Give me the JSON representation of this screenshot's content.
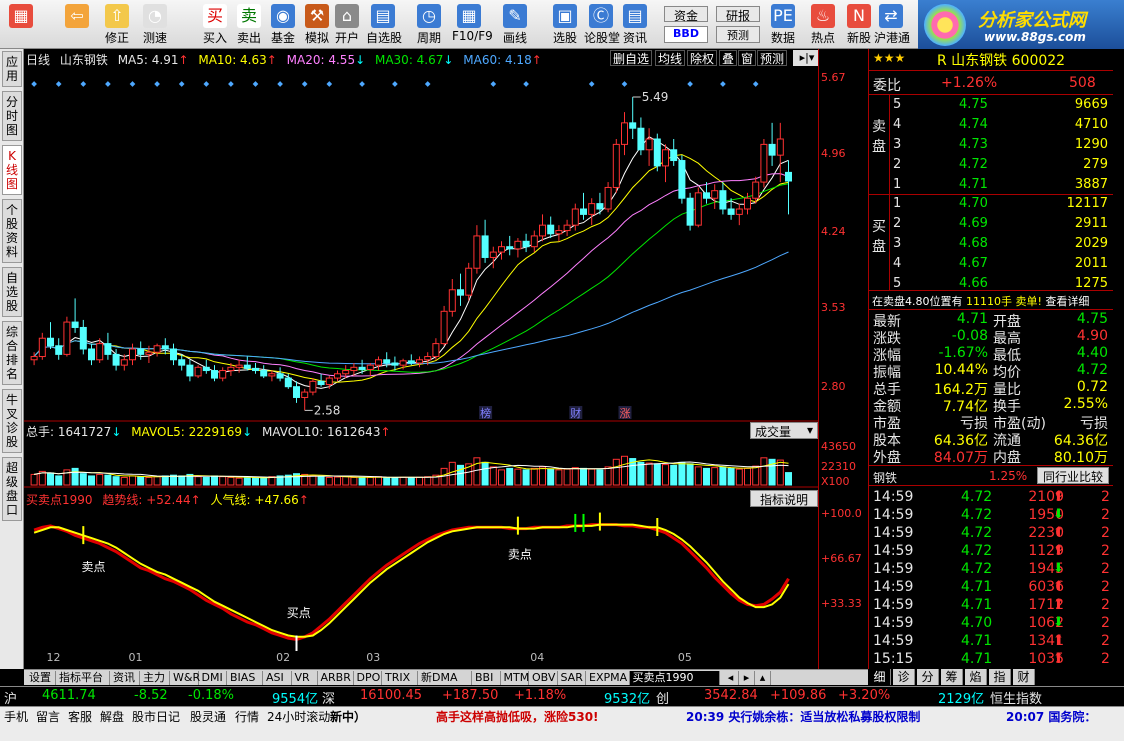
{
  "toolbar": {
    "buttons": [
      {
        "label": "",
        "icon": "home-grid-icon"
      },
      {
        "label": "",
        "icon": "back-icon"
      },
      {
        "label": "修正",
        "icon": "refresh-icon"
      },
      {
        "label": "测速",
        "icon": "clock-icon"
      },
      {
        "label": "买入",
        "icon": "buy-icon"
      },
      {
        "label": "卖出",
        "icon": "sell-icon"
      },
      {
        "label": "基金",
        "icon": "fund-icon"
      },
      {
        "label": "模拟",
        "icon": "hammer-icon"
      },
      {
        "label": "开户",
        "icon": "lock-icon"
      },
      {
        "label": "自选股",
        "icon": "watchlist-icon"
      },
      {
        "label": "周期",
        "icon": "period-icon"
      },
      {
        "label": "F10/F9",
        "icon": "f10-icon"
      },
      {
        "label": "画线",
        "icon": "pen-icon"
      },
      {
        "label": "选股",
        "icon": "screen-icon"
      },
      {
        "label": "论股堂",
        "icon": "forum-icon"
      },
      {
        "label": "资讯",
        "icon": "news-icon"
      },
      {
        "label": "资金",
        "icon": "capital-icon"
      },
      {
        "label": "研报",
        "icon": "report-icon"
      },
      {
        "label": "数据",
        "icon": "pe-icon"
      },
      {
        "label": "热点",
        "icon": "hot-icon"
      },
      {
        "label": "新股",
        "icon": "newstock-icon"
      },
      {
        "label": "沪港通",
        "icon": "hk-icon"
      }
    ],
    "bbd": "BBD",
    "forecast": "预测"
  },
  "logo": {
    "text": "分析家公式网",
    "url": "www.88gs.com"
  },
  "left_tabs": [
    "应用",
    "分时图",
    "K线图",
    "个股资料",
    "自选股",
    "综合排名",
    "牛叉诊股",
    "超级盘口"
  ],
  "chart_header": {
    "period": "日线",
    "name": "山东钢铁",
    "ma5": "MA5: 4.91",
    "ma10": "MA10: 4.63",
    "ma20": "MA20: 4.55",
    "ma30": "MA30: 4.67",
    "ma60": "MA60: 4.18",
    "btns": [
      "删自选",
      "均线",
      "除权",
      "叠",
      "窗",
      "预测"
    ]
  },
  "price_axis": [
    "5.67",
    "4.96",
    "4.24",
    "3.53",
    "2.80"
  ],
  "annot": {
    "high": "5.49",
    "low": "2.58",
    "bang": "榜",
    "cai": "财",
    "zhang": "涨"
  },
  "vol_header": {
    "total": "总手: 1641727",
    "mavol5": "MAVOL5: 2229169",
    "mavol10": "MAVOL10: 1612643",
    "select": "成交量"
  },
  "vol_axis": [
    "43650",
    "22310",
    "X100"
  ],
  "ind_header": {
    "name": "买卖点1990",
    "trend": "趋势线: +52.44",
    "pop": "人气线: +47.66",
    "btn": "指标说明"
  },
  "ind_axis": [
    "+100.0",
    "+66.67",
    "+33.33"
  ],
  "ind_labels": {
    "sell1": "卖点",
    "sell2": "卖点",
    "buy": "买点"
  },
  "date_axis": [
    "12",
    "01",
    "02",
    "03",
    "04",
    "05"
  ],
  "bottom_tabs": [
    "设置",
    "指标平台",
    "资讯",
    "主力",
    "W&R",
    "DMI",
    "BIAS",
    "ASI",
    "VR",
    "ARBR",
    "DPO",
    "TRIX",
    "新DMA",
    "BBI",
    "MTM",
    "OBV",
    "SAR",
    "EXPMA",
    "买卖点1990"
  ],
  "panel": {
    "stars": "★★★",
    "code_title": "R 山东钢铁 600022",
    "webi": "委比",
    "webi_pct": "+1.26%",
    "webi_val": "508",
    "sell_label": "卖盘",
    "buy_label": "买盘",
    "asks": [
      {
        "n": "5",
        "p": "4.75",
        "v": "9669"
      },
      {
        "n": "4",
        "p": "4.74",
        "v": "4710"
      },
      {
        "n": "3",
        "p": "4.73",
        "v": "1290"
      },
      {
        "n": "2",
        "p": "4.72",
        "v": "279"
      },
      {
        "n": "1",
        "p": "4.71",
        "v": "3887"
      }
    ],
    "bids": [
      {
        "n": "1",
        "p": "4.70",
        "v": "12117"
      },
      {
        "n": "2",
        "p": "4.69",
        "v": "2911"
      },
      {
        "n": "3",
        "p": "4.68",
        "v": "2029"
      },
      {
        "n": "4",
        "p": "4.67",
        "v": "2011"
      },
      {
        "n": "5",
        "p": "4.66",
        "v": "1275"
      }
    ],
    "notice": "在卖盘4.80位置有",
    "notice2": "11110手 卖单!",
    "detail": "查看详细",
    "quote": [
      [
        "最新",
        "4.71",
        "开盘",
        "4.75"
      ],
      [
        "涨跌",
        "-0.08",
        "最高",
        "4.90"
      ],
      [
        "涨幅",
        "-1.67%",
        "最低",
        "4.40"
      ],
      [
        "振幅",
        "10.44%",
        "均价",
        "4.72"
      ],
      [
        "总手",
        "164.2万",
        "量比",
        "0.72"
      ],
      [
        "金额",
        "7.74亿",
        "换手",
        "2.55%"
      ],
      [
        "市盈",
        "亏损",
        "市盈(动)",
        "亏损"
      ],
      [
        "股本",
        "64.36亿",
        "流通",
        "64.36亿"
      ],
      [
        "外盘",
        "84.07万",
        "内盘",
        "80.10万"
      ]
    ],
    "industry": "钢铁",
    "industry_pct": "1.25%",
    "industry_btn": "同行业比较",
    "ticks": [
      [
        "14:59",
        "4.72",
        "2109",
        "2"
      ],
      [
        "14:59",
        "4.72",
        "1950",
        "2"
      ],
      [
        "14:59",
        "4.72",
        "2230",
        "2"
      ],
      [
        "14:59",
        "4.72",
        "1129",
        "2"
      ],
      [
        "14:59",
        "4.72",
        "1945",
        "2"
      ],
      [
        "14:59",
        "4.71",
        "6036",
        "2"
      ],
      [
        "14:59",
        "4.71",
        "1712",
        "2"
      ],
      [
        "14:59",
        "4.70",
        "1062",
        "2"
      ],
      [
        "14:59",
        "4.71",
        "1341",
        "2"
      ],
      [
        "15:15",
        "4.71",
        "1035",
        "2"
      ]
    ],
    "tabs": [
      "细",
      "诊",
      "分",
      "筹",
      "焰",
      "指",
      "财"
    ]
  },
  "index_bar": {
    "sh": "沪",
    "sh_val": "4611.74",
    "sh_chg": "-8.52",
    "sh_pct": "-0.18%",
    "sh_amt": "9554亿",
    "sz": "深",
    "sz_val": "16100.45",
    "sz_chg": "+187.50",
    "sz_pct": "+1.18%",
    "sz_amt": "9532亿",
    "cy": "创",
    "cy_val": "3542.84",
    "cy_chg": "+109.86",
    "cy_pct": "+3.20%",
    "cy_amt": "2129亿",
    "hs": "恒生指数"
  },
  "status": {
    "items": [
      "手机",
      "留言",
      "客服",
      "解盘",
      "股市日记",
      "股灵通",
      "行情",
      "24小时滚动"
    ],
    "news1": "新中）",
    "news2": "高手这样高抛低吸，涨险530!",
    "news3": "20:39 央行姚余栋：适当放松私募股权限制",
    "news4": "20:07 国务院："
  },
  "colors": {
    "up": "#ff3232",
    "down": "#54ffff",
    "ma5": "#ffffff",
    "ma10": "#ffff00",
    "ma20": "#ff80ff",
    "ma30": "#00e600",
    "ma60": "#4ea8ff"
  },
  "chart_data": {
    "type": "candlestick",
    "series": [
      {
        "name": "日线",
        "x": "trading day index",
        "values": [
          [
            3.05,
            3.12,
            3.0,
            3.08
          ],
          [
            3.08,
            3.3,
            3.05,
            3.25
          ],
          [
            3.25,
            3.4,
            3.15,
            3.18
          ],
          [
            3.18,
            3.25,
            3.05,
            3.1
          ],
          [
            3.1,
            3.45,
            3.08,
            3.4
          ],
          [
            3.4,
            3.62,
            3.3,
            3.35
          ],
          [
            3.35,
            3.42,
            3.1,
            3.15
          ],
          [
            3.15,
            3.2,
            3.0,
            3.05
          ],
          [
            3.05,
            3.25,
            3.02,
            3.2
          ],
          [
            3.2,
            3.3,
            3.05,
            3.1
          ],
          [
            3.1,
            3.15,
            2.95,
            3.0
          ],
          [
            3.0,
            3.1,
            2.95,
            3.05
          ],
          [
            3.05,
            3.2,
            3.0,
            3.15
          ],
          [
            3.15,
            3.22,
            3.05,
            3.1
          ],
          [
            3.1,
            3.18,
            3.02,
            3.12
          ],
          [
            3.12,
            3.2,
            3.08,
            3.18
          ],
          [
            3.18,
            3.25,
            3.1,
            3.15
          ],
          [
            3.15,
            3.2,
            3.0,
            3.05
          ],
          [
            3.05,
            3.1,
            2.95,
            3.0
          ],
          [
            3.0,
            3.05,
            2.85,
            2.9
          ],
          [
            2.9,
            3.0,
            2.88,
            2.98
          ],
          [
            2.98,
            3.05,
            2.92,
            2.95
          ],
          [
            2.95,
            3.0,
            2.85,
            2.88
          ],
          [
            2.88,
            2.98,
            2.85,
            2.95
          ],
          [
            2.95,
            3.02,
            2.9,
            2.98
          ],
          [
            2.98,
            3.05,
            2.93,
            3.0
          ],
          [
            3.0,
            3.08,
            2.95,
            2.97
          ],
          [
            2.97,
            3.02,
            2.92,
            2.95
          ],
          [
            2.95,
            3.0,
            2.88,
            2.9
          ],
          [
            2.9,
            2.95,
            2.85,
            2.92
          ],
          [
            2.92,
            2.98,
            2.85,
            2.88
          ],
          [
            2.88,
            2.92,
            2.78,
            2.8
          ],
          [
            2.8,
            2.85,
            2.65,
            2.7
          ],
          [
            2.7,
            2.78,
            2.58,
            2.75
          ],
          [
            2.75,
            2.88,
            2.72,
            2.85
          ],
          [
            2.85,
            2.92,
            2.8,
            2.82
          ],
          [
            2.82,
            2.9,
            2.78,
            2.88
          ],
          [
            2.88,
            2.95,
            2.85,
            2.92
          ],
          [
            2.92,
            3.0,
            2.88,
            2.95
          ],
          [
            2.95,
            3.02,
            2.9,
            2.98
          ],
          [
            2.98,
            3.05,
            2.92,
            2.96
          ],
          [
            2.96,
            3.02,
            2.9,
            3.0
          ],
          [
            3.0,
            3.08,
            2.95,
            3.05
          ],
          [
            3.05,
            3.12,
            2.98,
            3.02
          ],
          [
            3.02,
            3.08,
            2.95,
            3.0
          ],
          [
            3.0,
            3.06,
            2.96,
            3.04
          ],
          [
            3.04,
            3.1,
            3.0,
            3.02
          ],
          [
            3.02,
            3.08,
            2.98,
            3.05
          ],
          [
            3.05,
            3.12,
            3.0,
            3.08
          ],
          [
            3.08,
            3.25,
            3.05,
            3.2
          ],
          [
            3.2,
            3.55,
            3.18,
            3.5
          ],
          [
            3.5,
            3.8,
            3.45,
            3.7
          ],
          [
            3.7,
            3.85,
            3.55,
            3.65
          ],
          [
            3.65,
            3.95,
            3.6,
            3.9
          ],
          [
            3.9,
            4.3,
            3.85,
            4.2
          ],
          [
            4.2,
            4.35,
            3.95,
            4.0
          ],
          [
            4.0,
            4.1,
            3.9,
            4.05
          ],
          [
            4.05,
            4.15,
            3.98,
            4.1
          ],
          [
            4.1,
            4.2,
            4.02,
            4.08
          ],
          [
            4.08,
            4.18,
            4.0,
            4.15
          ],
          [
            4.15,
            4.22,
            4.05,
            4.1
          ],
          [
            4.1,
            4.25,
            4.05,
            4.2
          ],
          [
            4.2,
            4.4,
            4.15,
            4.3
          ],
          [
            4.3,
            4.38,
            4.18,
            4.22
          ],
          [
            4.22,
            4.3,
            4.15,
            4.25
          ],
          [
            4.25,
            4.35,
            4.2,
            4.3
          ],
          [
            4.3,
            4.5,
            4.25,
            4.45
          ],
          [
            4.45,
            4.6,
            4.35,
            4.4
          ],
          [
            4.4,
            4.55,
            4.3,
            4.5
          ],
          [
            4.5,
            4.6,
            4.4,
            4.45
          ],
          [
            4.45,
            4.7,
            4.42,
            4.65
          ],
          [
            4.65,
            5.1,
            4.6,
            5.05
          ],
          [
            5.05,
            5.35,
            4.95,
            5.25
          ],
          [
            5.25,
            5.49,
            5.1,
            5.2
          ],
          [
            5.2,
            5.3,
            4.95,
            5.0
          ],
          [
            5.0,
            5.2,
            4.85,
            5.1
          ],
          [
            5.1,
            5.15,
            4.8,
            4.85
          ],
          [
            4.85,
            5.05,
            4.7,
            5.0
          ],
          [
            5.0,
            5.1,
            4.85,
            4.9
          ],
          [
            4.9,
            4.95,
            4.5,
            4.55
          ],
          [
            4.55,
            4.6,
            4.25,
            4.3
          ],
          [
            4.3,
            4.65,
            4.28,
            4.6
          ],
          [
            4.6,
            4.7,
            4.5,
            4.55
          ],
          [
            4.55,
            4.68,
            4.45,
            4.62
          ],
          [
            4.62,
            4.7,
            4.4,
            4.45
          ],
          [
            4.45,
            4.55,
            4.35,
            4.4
          ],
          [
            4.4,
            4.5,
            4.3,
            4.45
          ],
          [
            4.45,
            4.6,
            4.4,
            4.55
          ],
          [
            4.55,
            4.75,
            4.5,
            4.7
          ],
          [
            4.7,
            5.1,
            4.65,
            5.05
          ],
          [
            5.05,
            5.25,
            4.85,
            4.95
          ],
          [
            4.95,
            5.25,
            4.7,
            5.1
          ],
          [
            4.79,
            4.9,
            4.4,
            4.71
          ]
        ]
      },
      {
        "name": "总手",
        "values": [
          14000,
          18000,
          16000,
          12000,
          20000,
          22000,
          15000,
          12000,
          14000,
          13000,
          11000,
          10000,
          12000,
          11000,
          10000,
          11000,
          12000,
          13000,
          12000,
          14000,
          11000,
          10000,
          12000,
          11000,
          10000,
          9000,
          10000,
          9500,
          10000,
          11000,
          12000,
          13000,
          15000,
          14000,
          12000,
          11000,
          10000,
          10500,
          11000,
          10000,
          9500,
          10000,
          11000,
          10000,
          9800,
          10200,
          9900,
          10300,
          11000,
          13000,
          22000,
          30000,
          26000,
          28000,
          36000,
          30000,
          24000,
          20000,
          22000,
          21000,
          20000,
          22000,
          24000,
          21000,
          20000,
          21000,
          23000,
          22000,
          21000,
          20000,
          24000,
          34000,
          38000,
          35000,
          30000,
          29000,
          28000,
          27000,
          26000,
          30000,
          28000,
          24000,
          22000,
          23000,
          24000,
          22000,
          21000,
          22000,
          25000,
          36000,
          34000,
          33000,
          16417
        ]
      },
      {
        "name": "趋势线",
        "values": [
          88,
          90,
          91,
          89,
          87,
          84,
          82,
          80,
          78,
          75,
          72,
          68,
          64,
          60,
          58,
          55,
          52,
          50,
          47,
          44,
          40,
          36,
          33,
          30,
          26,
          23,
          20,
          18,
          15,
          12,
          10,
          8,
          7,
          9,
          12,
          17,
          22,
          28,
          34,
          40,
          46,
          52,
          57,
          62,
          66,
          70,
          74,
          78,
          81,
          84,
          86,
          88,
          89,
          90,
          90,
          90,
          90,
          90,
          89,
          89,
          89,
          90,
          90,
          90,
          90,
          91,
          91,
          91,
          92,
          92,
          92,
          92,
          91,
          91,
          90,
          90,
          88,
          86,
          82,
          78,
          72,
          66,
          60,
          53,
          47,
          41,
          36,
          33,
          32,
          33,
          37,
          42,
          52
        ]
      },
      {
        "name": "人气线",
        "values": [
          86,
          88,
          90,
          90,
          88,
          86,
          84,
          82,
          80,
          78,
          75,
          71,
          67,
          63,
          60,
          57,
          55,
          52,
          49,
          46,
          43,
          39,
          35,
          32,
          29,
          26,
          23,
          20,
          17,
          14,
          12,
          10,
          9,
          9,
          10,
          14,
          19,
          25,
          31,
          37,
          43,
          49,
          54,
          59,
          63,
          67,
          71,
          75,
          79,
          82,
          85,
          87,
          88,
          89,
          90,
          90,
          90,
          90,
          90,
          89,
          89,
          89,
          90,
          90,
          90,
          90,
          91,
          91,
          91,
          92,
          92,
          92,
          92,
          92,
          91,
          90,
          90,
          88,
          85,
          81,
          76,
          70,
          64,
          57,
          50,
          44,
          38,
          34,
          31,
          31,
          33,
          38,
          48
        ]
      }
    ],
    "ylim": [
      2.5,
      5.75
    ]
  }
}
